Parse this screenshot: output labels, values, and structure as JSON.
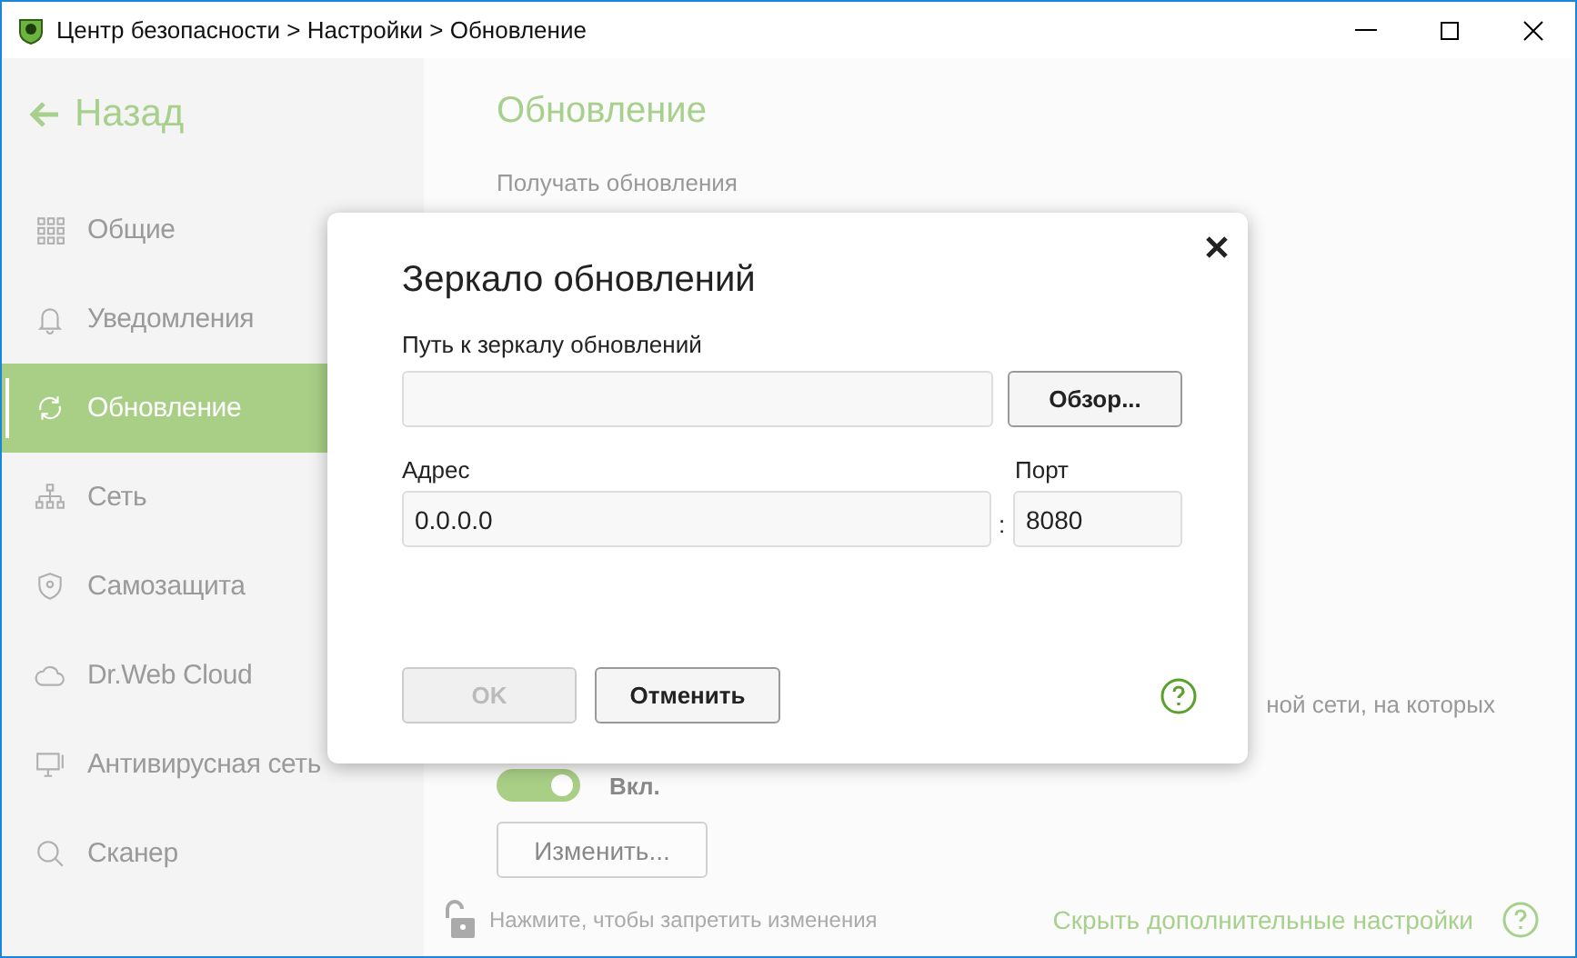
{
  "window": {
    "title": "Центр безопасности > Настройки > Обновление"
  },
  "sidebar": {
    "back": "Назад",
    "items": [
      {
        "label": "Общие",
        "selected": false
      },
      {
        "label": "Уведомления",
        "selected": false
      },
      {
        "label": "Обновление",
        "selected": true
      },
      {
        "label": "Сеть",
        "selected": false
      },
      {
        "label": "Самозащита",
        "selected": false
      },
      {
        "label": "Dr.Web Cloud",
        "selected": false
      },
      {
        "label": "Антивирусная сеть",
        "selected": false
      },
      {
        "label": "Сканер",
        "selected": false
      }
    ]
  },
  "main": {
    "heading": "Обновление",
    "subheading": "Получать обновления",
    "partial_text": "ной сети, на которых",
    "toggle": {
      "on": true,
      "label": "Вкл."
    },
    "change_button": "Изменить...",
    "footer": {
      "lock_hint": "Нажмите, чтобы запретить изменения",
      "link": "Скрыть дополнительные настройки"
    }
  },
  "dialog": {
    "title": "Зеркало обновлений",
    "path_label": "Путь к зеркалу обновлений",
    "browse_button": "Обзор...",
    "address_label": "Адрес",
    "address_value": "0.0.0.0",
    "separator": ":",
    "port_label": "Порт",
    "port_value": "8080",
    "ok": {
      "label": "OK",
      "disabled": true
    },
    "cancel": "Отменить"
  }
}
